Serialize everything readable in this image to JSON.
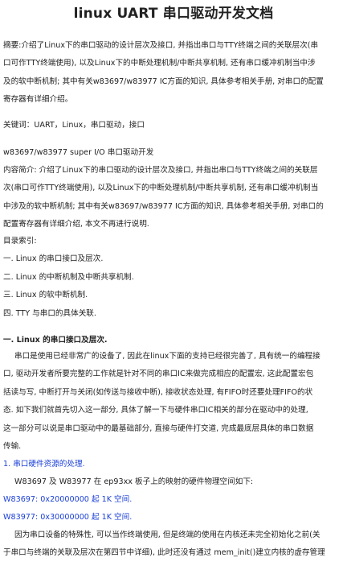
{
  "doc": {
    "title": "linux UART 串口驱动开发文档",
    "abstract_lines": [
      "摘要:介绍了Linux下的串口驱动的设计层次及接口, 并指出串口与TTY终端之间的关联层次(串",
      "口可作TTY终端使用), 以及Linux下的中断处理机制/中断共享机制, 还有串口缓冲机制当中涉",
      "及的软中断机制; 其中有关w83697/w83977 IC方面的知识, 具体参考相关手册, 对串口的配置",
      "寄存器有详细介绍。"
    ],
    "keywords": "关键词：UART，Linux，串口驱动，接口",
    "subtitle": "w83697/w83977 super I/O 串口驱动开发",
    "intro_lines": [
      "内容简介: 介绍了Linux下的串口驱动的设计层次及接口, 并指出串口与TTY终端之间的关联层",
      "次(串口可作TTY终端使用), 以及Linux下的中断处理机制/中断共享机制, 还有串口缓冲机制当",
      "中涉及的软中断机制; 其中有关w83697/w83977 IC方面的知识, 具体参考相关手册, 对串口的",
      "配置寄存器有详细介绍, 本文不再进行说明."
    ],
    "toc_label": "目录索引:",
    "toc_items": [
      "一. Linux 的串口接口及层次.",
      "二. Linux 的中断机制及中断共享机制.",
      "三. Linux 的软中断机制.",
      "四. TTY 与串口的具体关联."
    ],
    "section1_heading": "一. Linux 的串口接口及层次.",
    "section1_lines": [
      "串口是使用已经非常广的设备了, 因此在linux下面的支持已经很完善了, 具有统一的编程接",
      "口, 驱动开发者所要完整的工作就是针对不同的串口IC来做完成相应的配置宏, 这此配置宏包",
      "括读与写, 中断打开与关闭(如传送与接收中断), 接收状态处理, 有FIFO时还要处理FIFO的状",
      "态. 如下我们就首先切入这一部分, 具体了解一下与硬件串口IC相关的部分在驱动中的处理,",
      "这一部分可以说是串口驱动中的最基础部分, 直接与硬件打交道, 完成最底层具体的串口数据",
      "传输."
    ],
    "sub1_heading": "1. 串口硬件资源的处理.",
    "sub1_text": "W83697 及 W83977 在 ep93xx 板子上的映射的硬件物理空间如下:",
    "addr_w83697": "W83697: 0x20000000 起 1K 空间.",
    "addr_w83977": "W83977: 0x30000000 起 1K 空间.",
    "tail_lines": [
      "因为串口设备的特殊性, 可以当作终端使用, 但是终端的使用在内核还未完全初始化之前(关",
      "于串口与终端的关联及层次在第四节中详细), 此时还没有通过 mem_init()建立内核的虚存管理"
    ],
    "colors": {
      "text": "#222222",
      "link": "#1a3fd6"
    }
  }
}
